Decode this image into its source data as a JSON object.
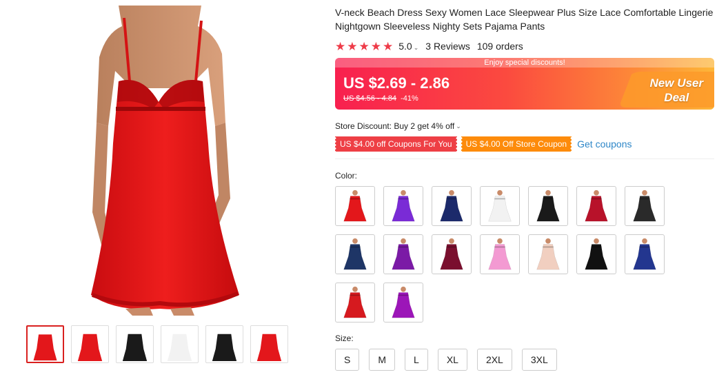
{
  "product": {
    "title": "V-neck Beach Dress Sexy Women Lace Sleepwear Plus Size Lace Comfortable Lingerie Nightgown Sleeveless Nighty Sets Pajama Pants",
    "rating": "5.0",
    "rating_chevron": "⌄",
    "reviews": "3 Reviews",
    "orders": "109 orders"
  },
  "price": {
    "banner": "Enjoy special discounts!",
    "current": "US $2.69 - 2.86",
    "original": "US $4.56 - 4.84",
    "discount": "-41%",
    "new_user_line1": "New User",
    "new_user_line2": "Deal",
    "accent": "#f8204f"
  },
  "discounts": {
    "store_discount": "Store Discount: Buy 2 get 4% off",
    "store_chevron": "⌄",
    "coupon_1": "US $4.00 off Coupons For You",
    "coupon_2": "US $4.00 Off Store Coupon",
    "get_coupons": "Get coupons"
  },
  "color_label": "Color:",
  "colors": [
    {
      "fill": "#e3171b"
    },
    {
      "fill": "#7a2bd6"
    },
    {
      "fill": "#1c2a6b"
    },
    {
      "fill": "#f2f2f2"
    },
    {
      "fill": "#1a1a1a"
    },
    {
      "fill": "#b8122a"
    },
    {
      "fill": "#2a2a2a"
    },
    {
      "fill": "#1e3566"
    },
    {
      "fill": "#7b1aa6"
    },
    {
      "fill": "#7a0f2e"
    },
    {
      "fill": "#f39ad2"
    },
    {
      "fill": "#f1cfc0"
    },
    {
      "fill": "#111111"
    },
    {
      "fill": "#23368f"
    },
    {
      "fill": "#d61a1f"
    },
    {
      "fill": "#9c16b8"
    }
  ],
  "size_label": "Size:",
  "sizes": [
    "S",
    "M",
    "L",
    "XL",
    "2XL",
    "3XL"
  ],
  "thumbnails": [
    {
      "fill": "#e3171b"
    },
    {
      "fill": "#e3171b"
    },
    {
      "fill": "#1a1a1a"
    },
    {
      "fill": "#f2f2f2"
    },
    {
      "fill": "#1a1a1a"
    },
    {
      "fill": "#e3171b"
    }
  ]
}
